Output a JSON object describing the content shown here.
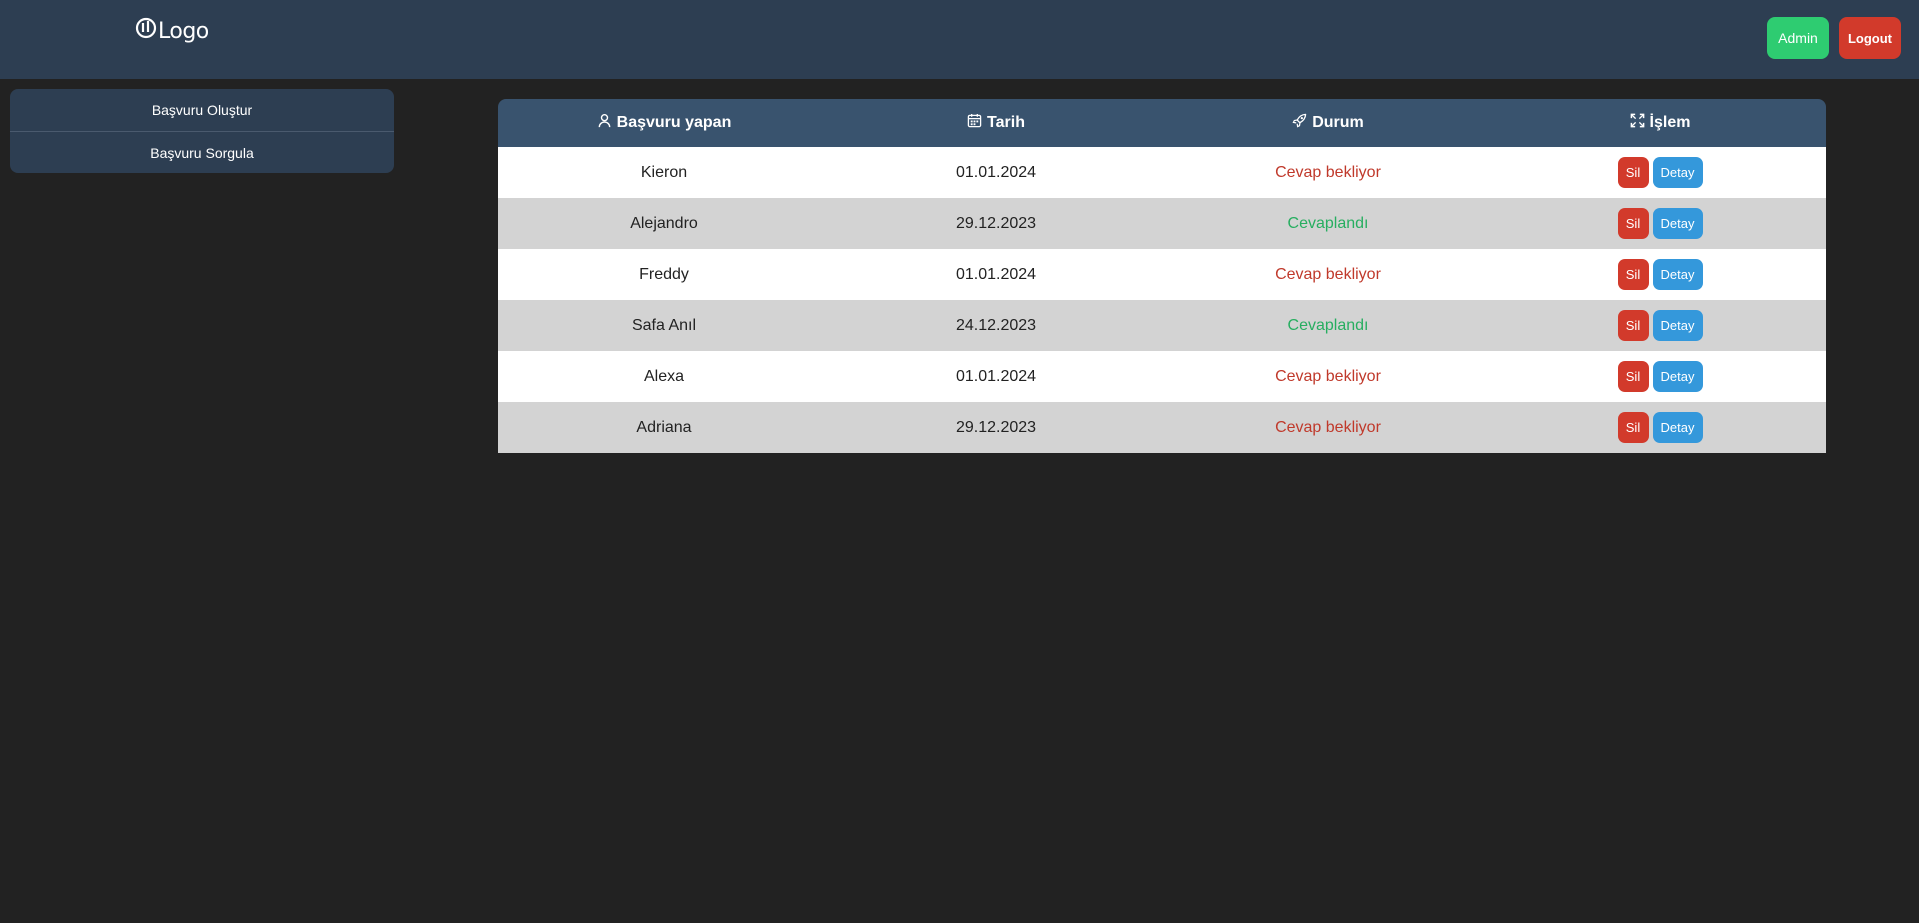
{
  "header": {
    "logo_text": "Logo",
    "logo_icon": "logo-icon",
    "admin_label": "Admin",
    "logout_label": "Logout"
  },
  "sidebar": {
    "items": [
      {
        "label": "Başvuru Oluştur"
      },
      {
        "label": "Başvuru Sorgula"
      }
    ]
  },
  "table": {
    "columns": [
      {
        "label": "Başvuru yapan",
        "icon": "user-icon"
      },
      {
        "label": "Tarih",
        "icon": "calendar-icon"
      },
      {
        "label": "Durum",
        "icon": "rocket-icon"
      },
      {
        "label": "İşlem",
        "icon": "expand-icon"
      }
    ],
    "rows": [
      {
        "name": "Kieron",
        "date": "01.01.2024",
        "status": "Cevap bekliyor",
        "status_type": "waiting",
        "delete_label": "Sil",
        "detail_label": "Detay"
      },
      {
        "name": "Alejandro",
        "date": "29.12.2023",
        "status": "Cevaplandı",
        "status_type": "answered",
        "delete_label": "Sil",
        "detail_label": "Detay"
      },
      {
        "name": "Freddy",
        "date": "01.01.2024",
        "status": "Cevap bekliyor",
        "status_type": "waiting",
        "delete_label": "Sil",
        "detail_label": "Detay"
      },
      {
        "name": "Safa Anıl",
        "date": "24.12.2023",
        "status": "Cevaplandı",
        "status_type": "answered",
        "delete_label": "Sil",
        "detail_label": "Detay"
      },
      {
        "name": "Alexa",
        "date": "01.01.2024",
        "status": "Cevap bekliyor",
        "status_type": "waiting",
        "delete_label": "Sil",
        "detail_label": "Detay"
      },
      {
        "name": "Adriana",
        "date": "29.12.2023",
        "status": "Cevap bekliyor",
        "status_type": "waiting",
        "delete_label": "Sil",
        "detail_label": "Detay"
      }
    ]
  },
  "colors": {
    "header_bg": "#2d3e52",
    "page_bg": "#222222",
    "table_header_bg": "#39536e",
    "admin_green": "#2ecc71",
    "danger_red": "#d23a2b",
    "info_blue": "#3498db",
    "status_waiting": "#c0392b",
    "status_answered": "#27ae60"
  }
}
